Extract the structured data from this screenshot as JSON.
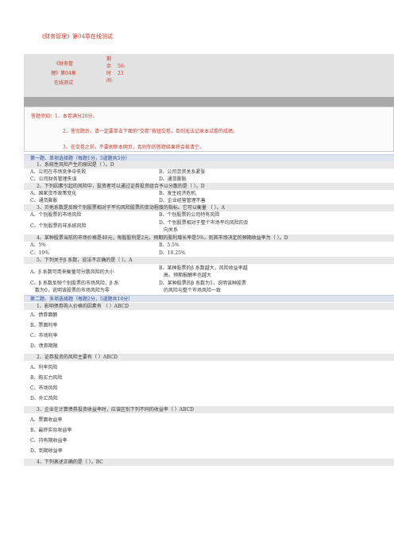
{
  "title": "《财务管理》第04章在线测试",
  "info": {
    "name_lines": [
      "《财务管",
      "理》第04章",
      "在线测试"
    ],
    "timer_lines": [
      [
        "剩",
        ""
      ],
      [
        "余",
        "56:"
      ],
      [
        "时",
        "23"
      ],
      [
        "间:",
        ""
      ]
    ]
  },
  "notice": [
    "答题须知：1、本卷满分20分。",
    "2、答完题后，请一定要单击下面的“交卷”按钮交卷，否则无法记录本试卷的成绩。",
    "3、在交卷之前，不要刷新本网页，否则你的答题结果将会被清空。"
  ],
  "section1": "第一题、单项选择题（每题1分，5道题共5分）",
  "q1": {
    "stem": "1、系统性风险产生的原因是（ ）。D",
    "a": "A、公司在市场竞争中失败",
    "b": "B、公司劳资关系紧张",
    "c": "C、公司财务管理失误",
    "d": "D、通货膨胀"
  },
  "q2": {
    "stem": "2、下列因素引起的风险中，投资者可以通过证券投资组合予以分散的是（ ）。D",
    "a": "A、国家货币政策变化",
    "b": "B、发生经济危机",
    "c": "C、通货膨胀",
    "d": "D、企业经营管理不善"
  },
  "q3": {
    "stem": "3、贝他系数是反映个别股票相对于平均风险股票的变动程度的指标。它可以衡量 （ ）。A",
    "a": "A、个别股票的市场风险",
    "b": "B、个别股票的公司特有风险",
    "c": "C、个别股票的非系统风险",
    "d1": "D、个别股票相对于整个市场平均风险的反",
    "d2": "向关系"
  },
  "q4": {
    "stem": "4、某种股票当前的市场价格是40元，每股股利是2元，预期的股利增长率是5%，则其市场决定的预期收益率为（ ）。D",
    "a": "A、5%",
    "b": "B、5.5%",
    "c": "C、10%",
    "d": "D、10.25%"
  },
  "q5": {
    "stem": "5、下列关于β 系数，说法不正确的是（ ）。A",
    "a": "A、β 系数可用来衡量可分散风险的大小",
    "b1": "B、某种股票的β 系数越大，风险收益率越",
    "b2": "高，预期报酬率也越大",
    "c1": "C、β 系数反映个别股票的市场风险，β 系",
    "c2": "数为0，说明该股票的市场风险为零",
    "d1": "D、某种股票的β 系数为1，说明该种股票",
    "d2": "的风险与整个市场风险一致"
  },
  "section2": "第二题、多项选择题（每题2分，5道题共10分）",
  "m1": {
    "stem": "1、影响债券购入价格的因素有 （ ）ABCD",
    "opts": [
      "A、债券面额",
      "B、票面利率",
      "C、市场利率",
      "D、债券期限"
    ]
  },
  "m2": {
    "stem": "2、证券投资的风险主要有（ ）ABCD",
    "opts": [
      "A、利率风险",
      "B、购买力风险",
      "C、市场风险",
      "D、外汇风险"
    ]
  },
  "m3": {
    "stem": "3、企业在计算债券投资收益率时，应该区别下列不同的收益率（ ）ABCD",
    "opts": [
      "A、票面收益率",
      "B、最终实际收益率",
      "C、持有期收益率",
      "D、到期收益率"
    ]
  },
  "m4": {
    "stem": "4、下列表述正确的是（ ）。BC"
  }
}
